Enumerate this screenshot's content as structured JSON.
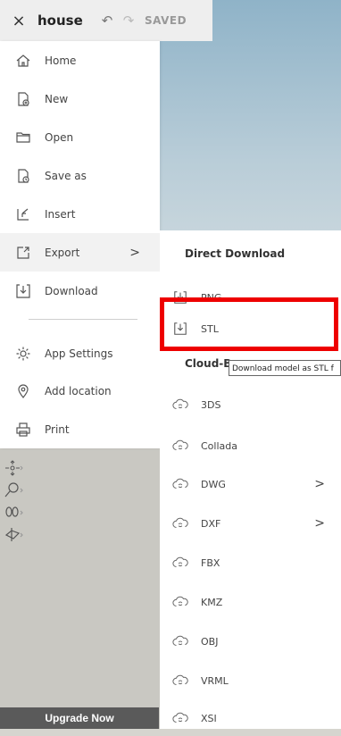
{
  "header": {
    "close_glyph": "×",
    "title": "house",
    "undo_glyph": "↶",
    "redo_glyph": "↷",
    "status": "SAVED"
  },
  "menu": {
    "items": [
      {
        "label": "Home",
        "icon": "home-icon"
      },
      {
        "label": "New",
        "icon": "new-file-icon"
      },
      {
        "label": "Open",
        "icon": "folder-icon"
      },
      {
        "label": "Save as",
        "icon": "save-as-icon"
      },
      {
        "label": "Insert",
        "icon": "insert-icon"
      },
      {
        "label": "Export",
        "icon": "export-icon",
        "active": true
      },
      {
        "label": "Download",
        "icon": "download-icon"
      },
      {
        "label": "App Settings",
        "icon": "gear-icon"
      },
      {
        "label": "Add location",
        "icon": "location-pin-icon"
      },
      {
        "label": "Print",
        "icon": "printer-icon"
      }
    ],
    "submenu_arrow": ">"
  },
  "export_menu": {
    "direct_heading": "Direct Download",
    "direct_items": [
      {
        "label": "PNG",
        "icon": "download-icon"
      },
      {
        "label": "STL",
        "icon": "download-icon"
      }
    ],
    "cloud_heading": "Cloud-B",
    "cloud_items": [
      {
        "label": "3DS",
        "has_submenu": false
      },
      {
        "label": "Collada",
        "has_submenu": false
      },
      {
        "label": "DWG",
        "has_submenu": true
      },
      {
        "label": "DXF",
        "has_submenu": true
      },
      {
        "label": "FBX",
        "has_submenu": false
      },
      {
        "label": "KMZ",
        "has_submenu": false
      },
      {
        "label": "OBJ",
        "has_submenu": false
      },
      {
        "label": "VRML",
        "has_submenu": false
      },
      {
        "label": "XSI",
        "has_submenu": false
      }
    ],
    "arrow": ">"
  },
  "tooltip": "Download model as STL f",
  "upgrade": {
    "label": "Upgrade Now"
  },
  "colors": {
    "highlight": "#ee0000",
    "upgrade_bg": "#5a5a5a"
  }
}
